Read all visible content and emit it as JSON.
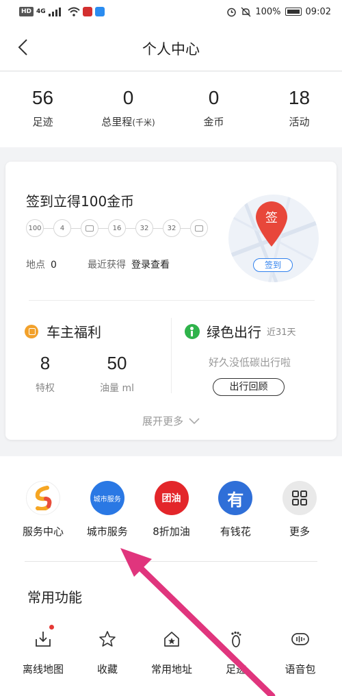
{
  "status_bar": {
    "network": "HD",
    "signal": "4G",
    "battery": "100%",
    "time": "09:02"
  },
  "header": {
    "title": "个人中心"
  },
  "stats": [
    {
      "value": "56",
      "label": "足迹"
    },
    {
      "value": "0",
      "label": "总里程",
      "unit": "(千米)"
    },
    {
      "value": "0",
      "label": "金币"
    },
    {
      "value": "18",
      "label": "活动"
    }
  ],
  "checkin": {
    "title": "签到立得100金币",
    "days": [
      "100",
      "4",
      "",
      "16",
      "32",
      "32",
      ""
    ],
    "location_label": "地点",
    "location_value": "0",
    "recent_label": "最近获得",
    "recent_value": "登录查看",
    "pin_label": "签",
    "button": "签到"
  },
  "owner": {
    "title": "车主福利",
    "items": [
      {
        "value": "8",
        "label": "特权"
      },
      {
        "value": "50",
        "label": "油量 ml"
      }
    ]
  },
  "green": {
    "title": "绿色出行",
    "days": "近31天",
    "subtitle": "好久没低碳出行啦",
    "button": "出行回顾"
  },
  "expand_label": "展开更多",
  "services": [
    {
      "label": "服务中心",
      "icon": "service-center-icon",
      "color": "#ffffff"
    },
    {
      "label": "城市服务",
      "icon": "city-service-icon",
      "color": "#2a78e4",
      "badge": "城市服务"
    },
    {
      "label": "8折加油",
      "icon": "fuel-icon",
      "color": "#e3262a",
      "badge": "团油"
    },
    {
      "label": "有钱花",
      "icon": "loan-icon",
      "color": "#2f6fd8",
      "badge": "有"
    },
    {
      "label": "更多",
      "icon": "more-grid-icon",
      "color": "#e9e9e9"
    }
  ],
  "common": {
    "title": "常用功能",
    "items": [
      {
        "label": "离线地图",
        "icon": "download-map-icon"
      },
      {
        "label": "收藏",
        "icon": "star-icon"
      },
      {
        "label": "常用地址",
        "icon": "home-star-icon"
      },
      {
        "label": "足迹",
        "icon": "footprint-icon"
      },
      {
        "label": "语音包",
        "icon": "voice-pack-icon"
      }
    ]
  },
  "accent_color": "#2f80ed",
  "annotation_arrow_color": "#e0357d"
}
